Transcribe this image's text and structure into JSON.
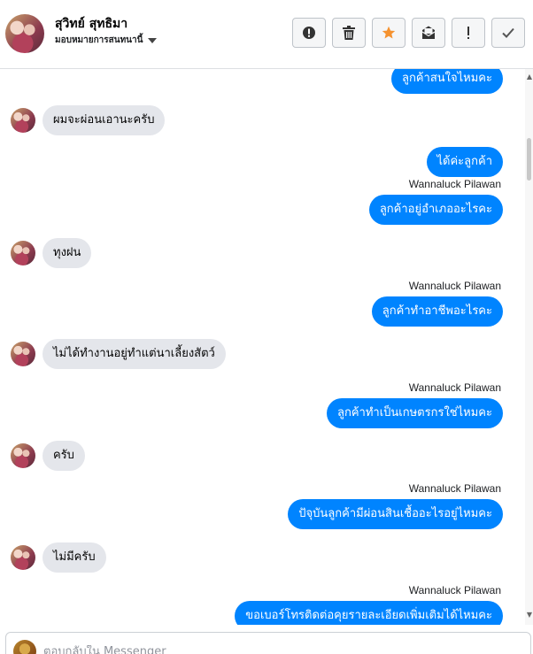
{
  "header": {
    "name": "สุวิทย์ สุทธิมา",
    "assigned_label": "มอบหมายการสนทนานี้"
  },
  "toolbar": {
    "buttons": [
      {
        "icon": "alert-circle-icon",
        "label": "Mark as spam"
      },
      {
        "icon": "trash-icon",
        "label": "Delete"
      },
      {
        "icon": "star-icon",
        "label": "Star",
        "color": "#f5922f"
      },
      {
        "icon": "unread-envelope-icon",
        "label": "Mark as unread"
      },
      {
        "icon": "exclamation-icon",
        "label": "Follow up"
      },
      {
        "icon": "checkmark-icon",
        "label": "Done"
      }
    ]
  },
  "thread": {
    "messages": [
      {
        "direction": "out",
        "text": "ลูกค้าสนใจไหมคะ"
      },
      {
        "direction": "in",
        "text": "ผมจะผ่อนเอานะครับ"
      },
      {
        "direction": "out",
        "text": "ได้ค่ะลูกค้า"
      },
      {
        "direction": "out",
        "sender": "Wannaluck Pilawan",
        "text": "ลูกค้าอยู่อำเภออะไรคะ"
      },
      {
        "direction": "in",
        "text": "ทุงฝน"
      },
      {
        "direction": "out",
        "sender": "Wannaluck Pilawan",
        "text": "ลูกค้าทำอาชีพอะไรคะ"
      },
      {
        "direction": "in",
        "text": "ไม่ได้ทำงานอยู่ทำแต่นาเลี้ยงสัตว์"
      },
      {
        "direction": "out",
        "sender": "Wannaluck Pilawan",
        "text": "ลูกค้าทำเป็นเกษตรกรใช่ไหมคะ"
      },
      {
        "direction": "in",
        "text": "ครับ"
      },
      {
        "direction": "out",
        "sender": "Wannaluck Pilawan",
        "text": "ปัจุบันลูกค้ามีผ่อนสินเชื้ออะไรอยู่ไหมคะ"
      },
      {
        "direction": "in",
        "text": "ไม่มีครับ"
      },
      {
        "direction": "out",
        "sender": "Wannaluck Pilawan",
        "text": "ขอเบอร์โทรติดต่อคุยรายละเอียดเพิ่มเติมได้ไหมคะ"
      }
    ]
  },
  "composer": {
    "placeholder": "ตอบกลับใน Messenger"
  },
  "colors": {
    "outgoing_bubble": "#0084ff",
    "incoming_bubble": "#e4e6eb",
    "star": "#f5922f"
  }
}
